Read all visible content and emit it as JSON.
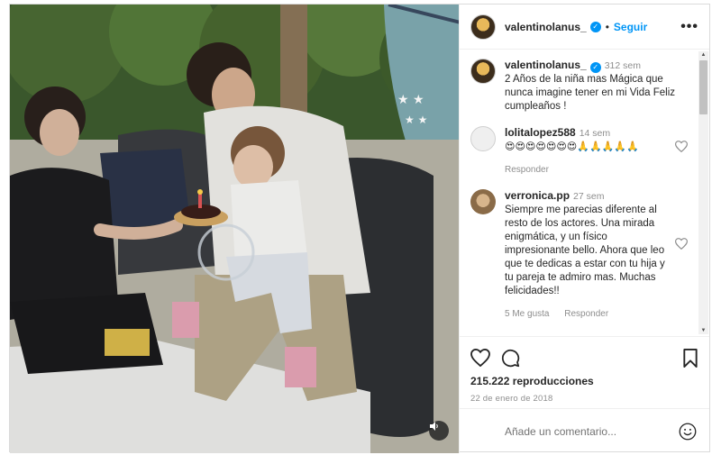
{
  "header": {
    "username": "valentinolanus_",
    "separator": "•",
    "follow_label": "Seguir",
    "more_label": "•••"
  },
  "caption": {
    "username": "valentinolanus_",
    "time": "312 sem",
    "text": "2 Años de la niña mas Mágica que nunca imagine tener en mi Vida Feliz cumpleaños !"
  },
  "comments": [
    {
      "username": "lolitalopez588",
      "time": "14 sem",
      "text": "😍😍😍😍😍😍😍🙏🙏🙏🙏🙏",
      "reply_label": "Responder"
    },
    {
      "username": "verronica.pp",
      "time": "27 sem",
      "text": "Siempre me parecias diferente al resto de los actores. Una mirada enigmática, y un físico impresionante bello. Ahora que leo que te dedicas a estar con tu hija y tu pareja te admiro mas. Muchas felicidades!!",
      "likes_label": "5 Me gusta",
      "reply_label": "Responder"
    }
  ],
  "stats": {
    "views": "215.222 reproducciones",
    "date": "22 de enero de 2018"
  },
  "add_comment": {
    "placeholder": "Añade un comentario..."
  },
  "icons": {
    "like": "heart-icon",
    "comment": "comment-icon",
    "save": "bookmark-icon",
    "emoji": "emoji-icon",
    "audio": "audio-muted-icon"
  },
  "colors": {
    "accent": "#0095f6",
    "muted": "#8e8e8e",
    "text": "#262626"
  }
}
